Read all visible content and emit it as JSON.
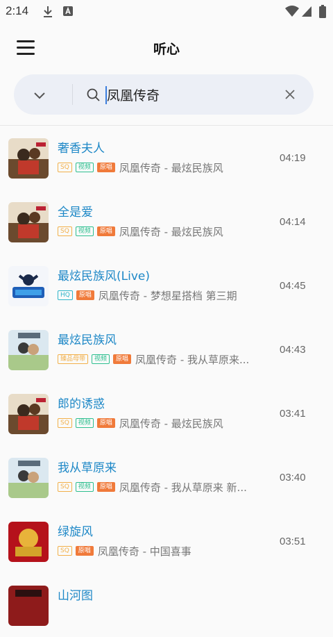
{
  "status_bar": {
    "time": "2:14"
  },
  "app_bar": {
    "title": "听心"
  },
  "search": {
    "value": "凤凰传奇"
  },
  "songs": [
    {
      "title": "奢香夫人",
      "tags": [
        "SQ",
        "视频",
        "原唱"
      ],
      "subtitle": "凤凰传奇 - 最炫民族风",
      "duration": "04:19"
    },
    {
      "title": "全是爱",
      "tags": [
        "SQ",
        "视频",
        "原唱"
      ],
      "subtitle": "凤凰传奇 - 最炫民族风",
      "duration": "04:14"
    },
    {
      "title": "最炫民族风(Live)",
      "tags": [
        "HQ",
        "原唱"
      ],
      "subtitle": "凤凰传奇 - 梦想星搭档 第三期",
      "duration": "04:45"
    },
    {
      "title": "最炫民族风",
      "tags": [
        "臻品母带",
        "视频",
        "原唱"
      ],
      "subtitle": "凤凰传奇 - 我从草原来...",
      "duration": "04:43"
    },
    {
      "title": "郎的诱惑",
      "tags": [
        "SQ",
        "视频",
        "原唱"
      ],
      "subtitle": "凤凰传奇 - 最炫民族风",
      "duration": "03:41"
    },
    {
      "title": "我从草原来",
      "tags": [
        "SQ",
        "视频",
        "原唱"
      ],
      "subtitle": "凤凰传奇 - 我从草原来 新...",
      "duration": "03:40"
    },
    {
      "title": "绿旋风",
      "tags": [
        "SQ",
        "原唱"
      ],
      "subtitle": "凤凰传奇 - 中国喜事",
      "duration": "03:51"
    },
    {
      "title": "山河图",
      "tags": [],
      "subtitle": "",
      "duration": ""
    }
  ],
  "colors": {
    "title_blue": "#1e88c7",
    "sq": "#f2b04a",
    "video": "#2dbf8f",
    "original": "#f07a3a",
    "search_bg": "#eceff6"
  }
}
